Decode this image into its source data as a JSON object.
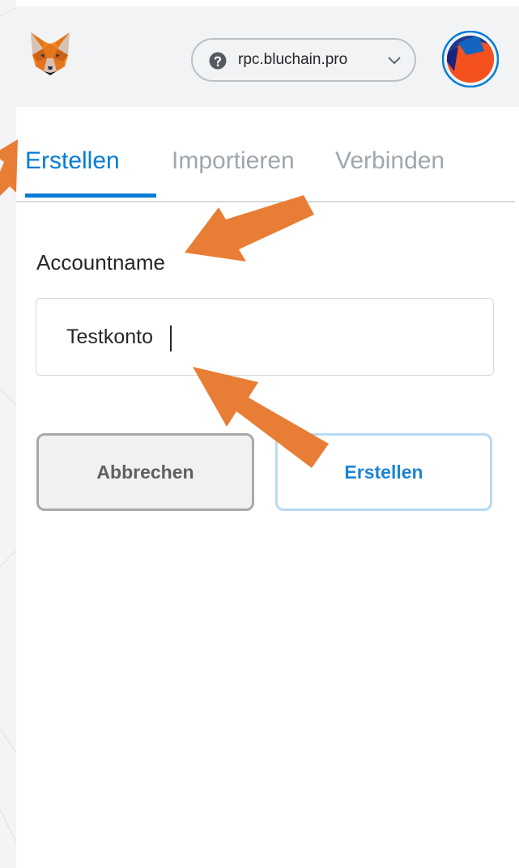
{
  "network": {
    "name": "rpc.bluchain.pro",
    "help_icon": "question-circle-icon",
    "chevron_icon": "chevron-down-icon"
  },
  "brand": {
    "logo": "metamask-fox-logo",
    "accent_color": "#037dd6",
    "arrow_color": "#e87e35"
  },
  "account": {
    "avatar_icon": "account-identicon"
  },
  "tabs": [
    {
      "label": "Erstellen",
      "active": true
    },
    {
      "label": "Importieren",
      "active": false
    },
    {
      "label": "Verbinden",
      "active": false
    }
  ],
  "form": {
    "label": "Accountname",
    "value": "Testkonto"
  },
  "actions": {
    "cancel_label": "Abbrechen",
    "create_label": "Erstellen"
  }
}
